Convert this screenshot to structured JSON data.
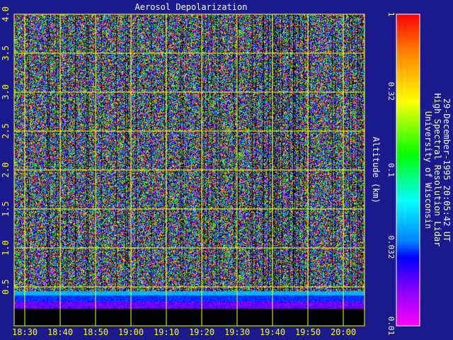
{
  "chart_data": {
    "type": "heatmap",
    "title": "Aerosol Depolarization",
    "ylabel": "Altitude (km)",
    "xlabel": "",
    "x_tick_labels": [
      "18:30",
      "18:40",
      "18:50",
      "19:00",
      "19:10",
      "19:20",
      "19:30",
      "19:40",
      "19:50",
      "20:00"
    ],
    "y_tick_labels": [
      "0.5",
      "1.0",
      "1.5",
      "2.0",
      "2.5",
      "3.0",
      "3.5",
      "4.0"
    ],
    "y_ticks": [
      0.5,
      1.0,
      1.5,
      2.0,
      2.5,
      3.0,
      3.5,
      4.0
    ],
    "ylim": [
      0.0,
      4.0
    ],
    "colorbar": {
      "scale": "log",
      "range": [
        0.01,
        1
      ],
      "tick_labels": [
        "1",
        "0.32",
        "0.1",
        "0.032",
        "0.01"
      ],
      "tick_values": [
        1,
        0.32,
        0.1,
        0.032,
        0.01
      ],
      "colors": [
        "#ff0000",
        "#ff8000",
        "#ffff00",
        "#00ff00",
        "#00ffff",
        "#0080ff",
        "#0000ff",
        "#8000ff",
        "#ff00ff"
      ]
    },
    "grid": true,
    "grid_color": "#ffff00",
    "background_color": "#1a1a8c",
    "no_data_color": "#000000",
    "caption": {
      "institution": "University of Wisconsin",
      "instrument": "High Spectral Resolution Lidar",
      "timestamp": "29-December-1995 20:05:42 UT"
    }
  }
}
